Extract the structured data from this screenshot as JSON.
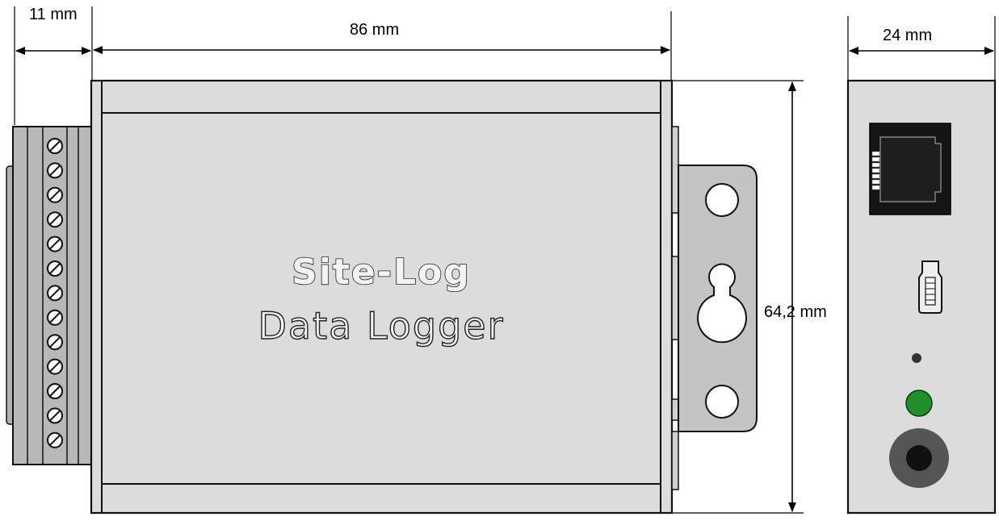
{
  "dimensions": {
    "terminal_depth": "11 mm",
    "body_length": "86 mm",
    "height": "64,2 mm",
    "width": "24 mm"
  },
  "device_label": {
    "line1": "Site-Log",
    "line2": "Data Logger"
  },
  "colors": {
    "body_fill": "#dcdcdc",
    "terminal_fill": "#b8b8b8",
    "bracket_fill": "#c4c4c4",
    "rj45_fill": "#151515",
    "led_green": "#1f8f2a",
    "power_jack_outer": "#555555",
    "power_jack_inner": "#111111"
  },
  "icons": {
    "terminal_screw": "terminal-screw-icon",
    "rj45_port": "rj45-port-icon",
    "mini_usb_port": "mini-usb-port-icon",
    "status_led": "led-icon",
    "power_jack": "power-jack-icon"
  }
}
